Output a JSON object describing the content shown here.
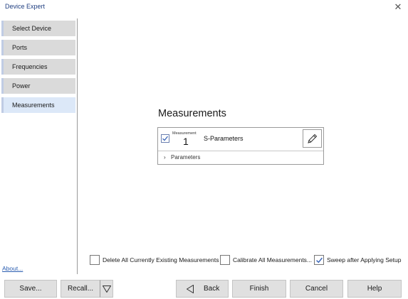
{
  "window": {
    "title": "Device Expert",
    "close_icon": "close-icon"
  },
  "sidebar": {
    "items": [
      {
        "label": "Select Device",
        "active": false
      },
      {
        "label": "Ports",
        "active": false
      },
      {
        "label": "Frequencies",
        "active": false
      },
      {
        "label": "Power",
        "active": false
      },
      {
        "label": "Measurements",
        "active": true
      }
    ],
    "about_link": "About..."
  },
  "main": {
    "title": "Measurements",
    "measurement": {
      "checked": true,
      "caption": "Measurement",
      "number": "1",
      "name": "S-Parameters",
      "edit_icon": "pencil-icon",
      "parameters_label": "Parameters",
      "parameters_icon": "chevron-right-icon"
    }
  },
  "options": [
    {
      "label": "Delete All Currently Existing Measurements",
      "checked": false
    },
    {
      "label": "Calibrate All Measurements...",
      "checked": false
    },
    {
      "label": "Sweep after Applying Setup",
      "checked": true
    }
  ],
  "buttons": {
    "save": "Save...",
    "recall": "Recall...",
    "recall_dropdown_icon": "triangle-down-icon",
    "back": "Back",
    "back_icon": "triangle-left-icon",
    "finish": "Finish",
    "cancel": "Cancel",
    "help": "Help"
  },
  "colors": {
    "title_text": "#1f3e80",
    "accent": "#2a5db0",
    "nav_active_bg": "#dce8f8",
    "nav_bg": "#dadada",
    "button_bg": "#e0e0e0"
  }
}
